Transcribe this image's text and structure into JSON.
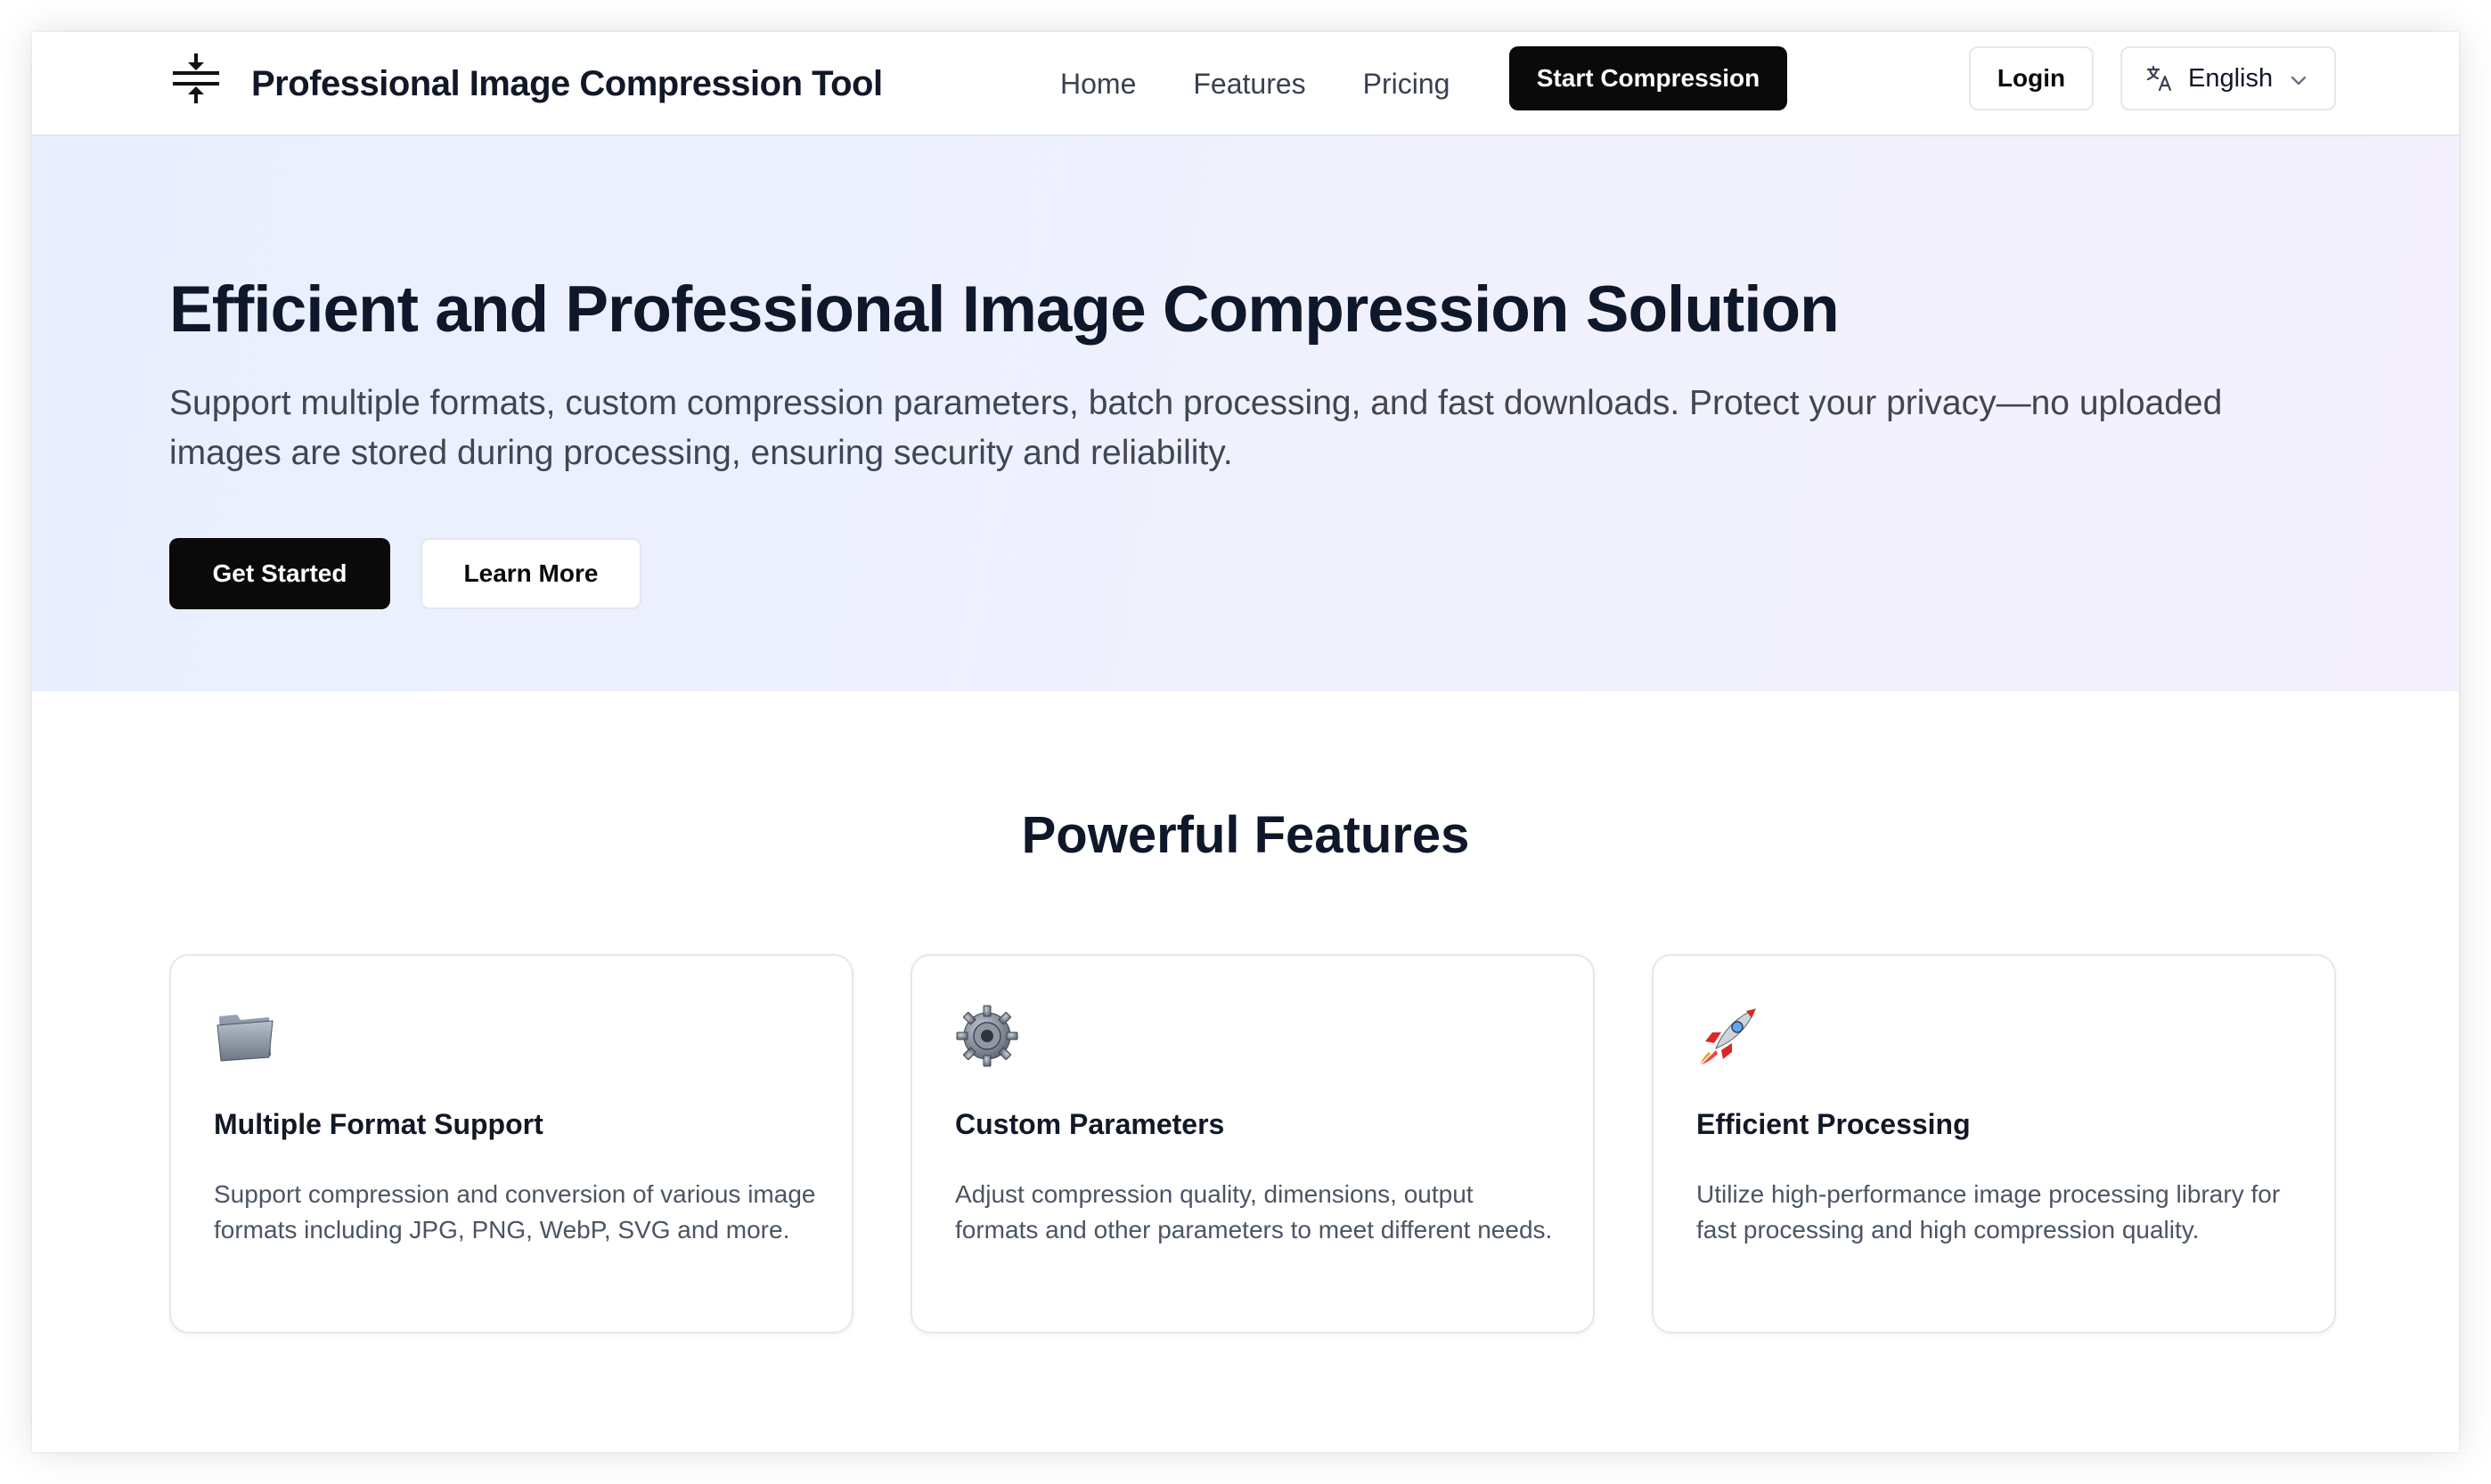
{
  "header": {
    "brand": "Professional Image Compression Tool",
    "nav": {
      "home": "Home",
      "features": "Features",
      "pricing": "Pricing"
    },
    "start_button": "Start Compression",
    "login_button": "Login",
    "language": "English"
  },
  "hero": {
    "title": "Efficient and Professional Image Compression Solution",
    "description": "Support multiple formats, custom compression parameters, batch processing, and fast downloads. Protect your privacy—no uploaded images are stored during processing, ensuring security and reliability.",
    "primary_button": "Get Started",
    "secondary_button": "Learn More"
  },
  "features": {
    "title": "Powerful Features",
    "items": [
      {
        "icon": "folder-icon",
        "title": "Multiple Format Support",
        "description": "Support compression and conversion of various image formats including JPG, PNG, WebP, SVG and more."
      },
      {
        "icon": "gear-icon",
        "title": "Custom Parameters",
        "description": "Adjust compression quality, dimensions, output formats and other parameters to meet different needs."
      },
      {
        "icon": "rocket-icon",
        "title": "Efficient Processing",
        "description": "Utilize high-performance image processing library for fast processing and high compression quality."
      }
    ]
  },
  "colors": {
    "primary": "#0a0a0a",
    "hero_bg_start": "#e9efff",
    "hero_bg_end": "#f4f1fc",
    "text_dark": "#0f172a",
    "text_muted": "#4b5563"
  }
}
